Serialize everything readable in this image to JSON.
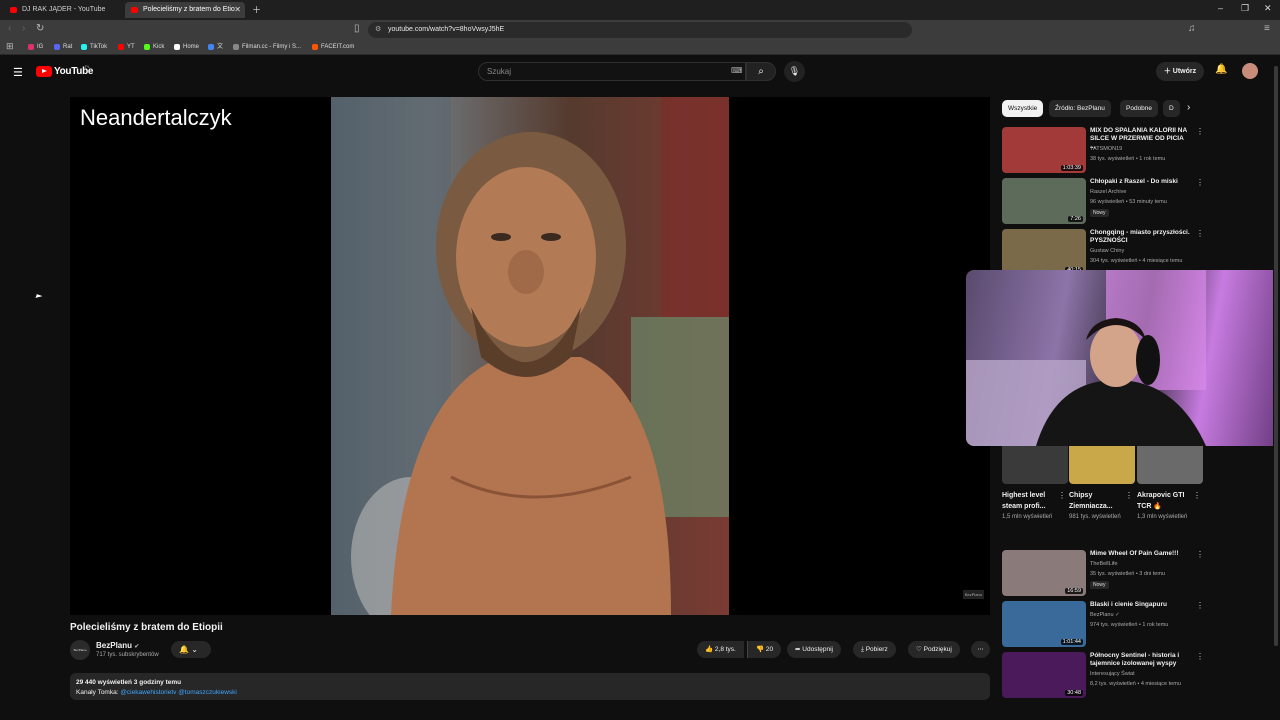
{
  "browser": {
    "tabs": [
      {
        "title": "DJ RAK JĄDER - YouTube",
        "active": false
      },
      {
        "title": "Polecieliśmy z bratem do Etio",
        "active": true
      }
    ],
    "url": "youtube.com/watch?v=8hoVwsyJ5hE",
    "bookmarks": [
      {
        "label": "IG",
        "color": "#e1306c"
      },
      {
        "label": "Rat",
        "color": "#5865f2"
      },
      {
        "label": "TikTok",
        "color": "#25f4ee"
      },
      {
        "label": "YT",
        "color": "#ff0000"
      },
      {
        "label": "Kick",
        "color": "#53fc18"
      },
      {
        "label": "Home",
        "color": "#ffffff"
      },
      {
        "label": "文",
        "color": "#4285f4"
      },
      {
        "label": "Filman.cc - Filmy i S...",
        "color": "#888888"
      },
      {
        "label": "FACEIT.com",
        "color": "#ff5500"
      }
    ]
  },
  "youtube": {
    "logo_text": "YouTube",
    "logo_region": "PL",
    "search_placeholder": "Szukaj",
    "create_label": "Utwórz"
  },
  "player": {
    "overlay_title": "Neandertalczyk",
    "watermark": "BezPlanu"
  },
  "video": {
    "title": "Polecieliśmy z bratem do Etiopii",
    "channel_avatar_text": "BezPlanu",
    "channel": "BezPlanu",
    "subscribers": "717 tys. subskrybentów",
    "likes": "2,8 tys.",
    "dislikes": "20",
    "share_label": "Udostępnij",
    "download_label": "Pobierz",
    "thanks_label": "Podziękuj",
    "views_line": "29 440 wyświetleń  3 godziny temu",
    "desc_prefix": "Kanały Tomka: ",
    "desc_links": "@ciekawehistorietv @tomaszczukiewski"
  },
  "sidebar": {
    "chips": [
      {
        "label": "Wszystkie",
        "selected": true
      },
      {
        "label": "Źródło: BezPlanu",
        "selected": false
      },
      {
        "label": "Podobne",
        "selected": false
      },
      {
        "label": "D",
        "selected": false
      }
    ],
    "videos_top": [
      {
        "title": "MIX DO SPALANIA KALORII NA SILCE W PRZERWIE OD PICIA ...",
        "channel": "TATSMON19",
        "meta": "38 tys. wyświetleń • 1 rok temu",
        "duration": "1:03:39",
        "badge": "",
        "thumb_color": "#a33a3a"
      },
      {
        "title": "Chłopaki z Raszel - Do miski",
        "channel": "Raszel Archive",
        "meta": "96 wyświetleń • 53 minuty temu",
        "duration": "7:26",
        "badge": "Nowy",
        "thumb_color": "#5c6b5a"
      },
      {
        "title": "Chongqing - miasto przyszłości. PYSZNOŚCI",
        "channel": "Gustaw Chiny",
        "meta": "304 tys. wyświetleń • 4 miesiące temu",
        "duration": "40:15",
        "badge": "",
        "thumb_color": "#7a6a4a"
      }
    ],
    "shorts": [
      {
        "title": "Highest level steam profi...",
        "meta": "1,5 mln wyświetleń",
        "thumb_color": "#3a3a3a"
      },
      {
        "title": "Chipsy Ziemniacza...",
        "meta": "981 tys. wyświetleń",
        "thumb_color": "#c9a84a"
      },
      {
        "title": "Akrapovic GTI TCR 🔥",
        "meta": "1,3 mln wyświetleń",
        "thumb_color": "#6a6a6a"
      }
    ],
    "videos_bottom": [
      {
        "title": "Mime Wheel Of Pain Game!!!",
        "channel": "TheBellLife",
        "meta": "35 tys. wyświetleń • 3 dni temu",
        "duration": "16:59",
        "badge": "Nowy",
        "thumb_color": "#8a7a7a"
      },
      {
        "title": "Blaski i cienie Singapuru",
        "channel": "BezPlanu ✓",
        "meta": "974 tys. wyświetleń • 1 rok temu",
        "duration": "1:01:44",
        "badge": "",
        "thumb_color": "#3a6a9a"
      },
      {
        "title": "Północny Sentinel - historia i tajemnice izolowanej wyspy",
        "channel": "Interesujący Świat",
        "meta": "8,2 tys. wyświetleń • 4 miesiące temu",
        "duration": "30:48",
        "badge": "",
        "thumb_color": "#4a1a5a"
      }
    ]
  }
}
